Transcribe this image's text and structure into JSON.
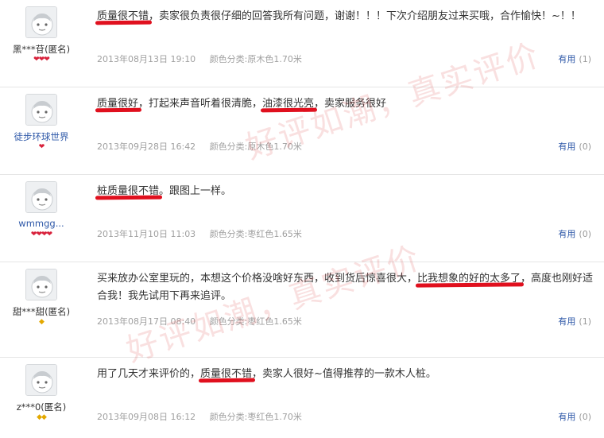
{
  "reviews": [
    {
      "user": "黑***苷(匿名)",
      "user_color": "#333333",
      "rank": {
        "type": "heart",
        "count": 3
      },
      "segments": [
        {
          "t": "质量很不错",
          "hl": true
        },
        {
          "t": "，卖家很负责很仔细的回答我所有问题，谢谢！！！下次介绍朋友过来买哦，合作愉快！~！！",
          "hl": false
        }
      ],
      "date": "2013年08月13日 19:10",
      "spec": "颜色分类:原木色1.70米",
      "useful_label": "有用",
      "useful_count": "(1)"
    },
    {
      "user": "徒步环球世界",
      "user_color": "#2e58a8",
      "rank": {
        "type": "heart",
        "count": 1
      },
      "segments": [
        {
          "t": "质量很好",
          "hl": true
        },
        {
          "t": "，打起来声音听着很清脆，",
          "hl": false
        },
        {
          "t": "油漆很光亮",
          "hl": true
        },
        {
          "t": "，卖家服务很好",
          "hl": false
        }
      ],
      "date": "2013年09月28日 16:42",
      "spec": "颜色分类:原木色1.70米",
      "useful_label": "有用",
      "useful_count": "(0)"
    },
    {
      "user": "wmmgg...",
      "user_color": "#2e58a8",
      "rank": {
        "type": "heart",
        "count": 4
      },
      "segments": [
        {
          "t": "桩质量很不错",
          "hl": true
        },
        {
          "t": "。跟图上一样。",
          "hl": false
        }
      ],
      "date": "2013年11月10日 11:03",
      "spec": "颜色分类:枣红色1.65米",
      "useful_label": "有用",
      "useful_count": "(0)"
    },
    {
      "user": "甜***甜(匿名)",
      "user_color": "#333333",
      "rank": {
        "type": "diamond",
        "count": 1
      },
      "segments": [
        {
          "t": "买来放办公室里玩的，本想这个价格没啥好东西，收到货后惊喜很大，",
          "hl": false
        },
        {
          "t": "比我想象的好的太多了",
          "hl": true
        },
        {
          "t": "，高度也刚好适合我！我先试用下再来追评。",
          "hl": false
        }
      ],
      "date": "2013年08月17日 08:40",
      "spec": "颜色分类:枣红色1.65米",
      "useful_label": "有用",
      "useful_count": "(1)"
    },
    {
      "user": "z***0(匿名)",
      "user_color": "#333333",
      "rank": {
        "type": "diamond",
        "count": 2
      },
      "segments": [
        {
          "t": "用了几天才来评价的，",
          "hl": false
        },
        {
          "t": "质量很不错",
          "hl": true
        },
        {
          "t": "，卖家人很好~值得推荐的一款木人桩。",
          "hl": false
        }
      ],
      "date": "2013年09月08日 16:12",
      "spec": "颜色分类:枣红色1.70米",
      "useful_label": "有用",
      "useful_count": "(0)"
    }
  ],
  "watermarks": [
    "好评如潮，真实评价",
    "好评如潮，真实评价"
  ],
  "colors": {
    "highlight": "#e0101e",
    "link": "#2e58a8",
    "meta": "#a0a0a0"
  }
}
